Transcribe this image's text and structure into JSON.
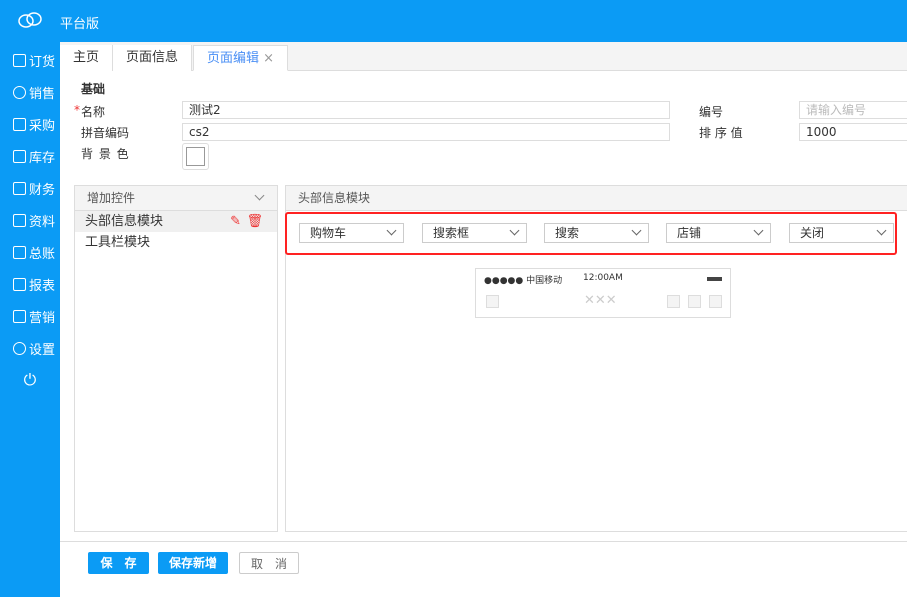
{
  "header": {
    "brand": "平台版"
  },
  "sidebar": {
    "items": [
      {
        "label": "订货"
      },
      {
        "label": "销售"
      },
      {
        "label": "采购"
      },
      {
        "label": "库存"
      },
      {
        "label": "财务"
      },
      {
        "label": "资料"
      },
      {
        "label": "总账"
      },
      {
        "label": "报表"
      },
      {
        "label": "营销"
      },
      {
        "label": "设置"
      }
    ],
    "power": "⏻"
  },
  "tabs": [
    {
      "label": "主页"
    },
    {
      "label": "页面信息"
    },
    {
      "label": "页面编辑",
      "close": "×"
    }
  ],
  "form": {
    "section": "基础",
    "required_mark": "*",
    "name_label": "名称",
    "name_value": "测试2",
    "pinyin_label": "拼音编码",
    "pinyin_value": "cs2",
    "bg_label": "背 景 色",
    "code_label": "编号",
    "code_placeholder": "请输入编号",
    "order_label": "排 序 值",
    "order_value": "1000"
  },
  "left_panel": {
    "title": "增加控件",
    "items": [
      {
        "label": "头部信息模块"
      },
      {
        "label": "工具栏模块"
      }
    ]
  },
  "right_panel": {
    "title": "头部信息模块",
    "selects": [
      {
        "value": "购物车"
      },
      {
        "value": "搜索框"
      },
      {
        "value": "搜索"
      },
      {
        "value": "店铺"
      },
      {
        "value": "关闭"
      }
    ]
  },
  "preview": {
    "signal": "●●●●● 中国移动",
    "time": "12:00AM",
    "title": "✕✕✕"
  },
  "footer": {
    "save": "保　存",
    "save_new": "保存新增",
    "cancel": "取　消"
  },
  "colors": {
    "primary": "#0b9bf5",
    "highlight": "#ff2020"
  }
}
